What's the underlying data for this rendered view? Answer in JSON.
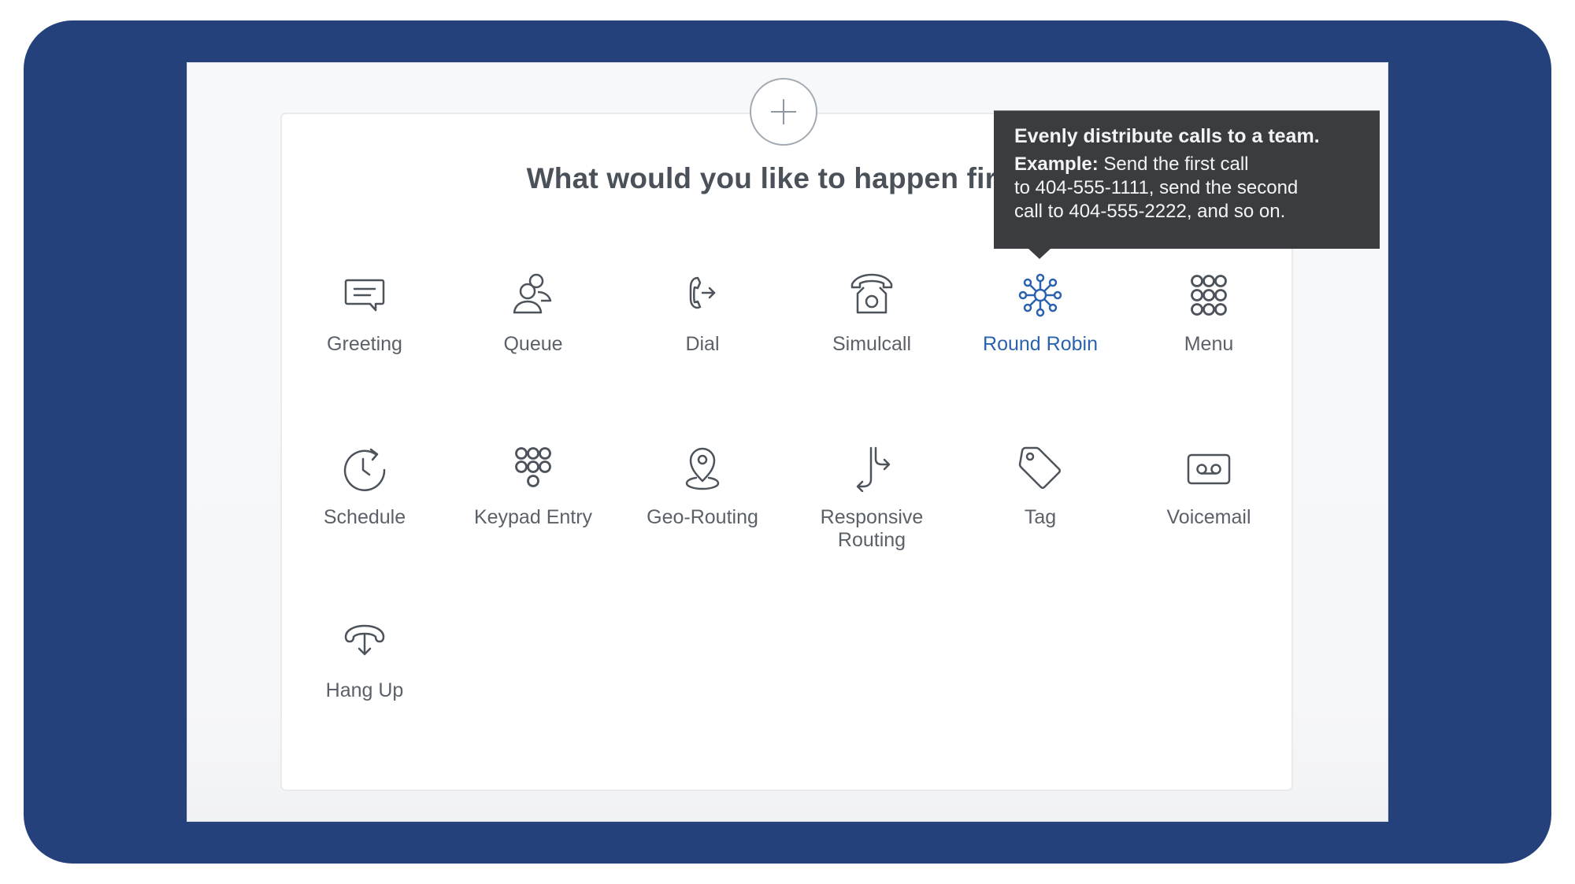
{
  "prompt": {
    "heading": "What would you like to happen first?",
    "add_button_label": "+"
  },
  "options": [
    {
      "id": "greeting",
      "label": "Greeting",
      "icon": "speech-bubble-icon",
      "active": false
    },
    {
      "id": "queue",
      "label": "Queue",
      "icon": "users-icon",
      "active": false
    },
    {
      "id": "dial",
      "label": "Dial",
      "icon": "phone-forward-icon",
      "active": false
    },
    {
      "id": "simulcall",
      "label": "Simulcall",
      "icon": "desk-phone-icon",
      "active": false
    },
    {
      "id": "round-robin",
      "label": "Round Robin",
      "icon": "hub-network-icon",
      "active": true
    },
    {
      "id": "menu",
      "label": "Menu",
      "icon": "keypad-grid-icon",
      "active": false
    },
    {
      "id": "schedule",
      "label": "Schedule",
      "icon": "clock-refresh-icon",
      "active": false
    },
    {
      "id": "keypad-entry",
      "label": "Keypad Entry",
      "icon": "dialpad-icon",
      "active": false
    },
    {
      "id": "geo-routing",
      "label": "Geo-Routing",
      "icon": "map-pin-icon",
      "active": false
    },
    {
      "id": "responsive-routing",
      "label_line1": "Responsive",
      "label_line2": "Routing",
      "icon": "split-arrows-icon",
      "active": false
    },
    {
      "id": "tag",
      "label": "Tag",
      "icon": "tag-icon",
      "active": false
    },
    {
      "id": "voicemail",
      "label": "Voicemail",
      "icon": "voicemail-icon",
      "active": false
    },
    {
      "id": "hang-up",
      "label": "Hang Up",
      "icon": "hang-up-icon",
      "active": false
    }
  ],
  "tooltip": {
    "title": "Evenly distribute calls to a team.",
    "example_label": "Example:",
    "example_line1": " Send the first call",
    "example_line2": "to 404-555-1111, send the second",
    "example_line3": "call to 404-555-2222, and so on."
  },
  "colors": {
    "frame": "#24417c",
    "accent": "#2b62ad",
    "icon": "#4d535a",
    "tooltip_bg": "#3a3c40"
  }
}
